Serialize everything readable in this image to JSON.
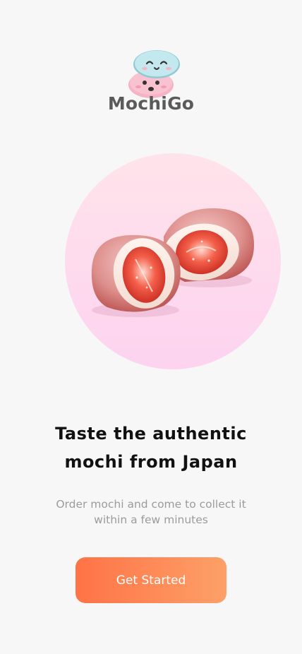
{
  "brand": {
    "name": "MochiGo",
    "logo_icon": "mochi-stack-icon",
    "text_color": "#5a5a5a"
  },
  "hero": {
    "image": "strawberry-mochi",
    "circle_gradient": [
      "#ffe3ea",
      "#fdd3f0"
    ]
  },
  "onboarding": {
    "headline_line1": "Taste the authentic",
    "headline_line2": "mochi from Japan",
    "subtitle_line1": "Order mochi and come to collect it",
    "subtitle_line2": "within a few minutes"
  },
  "cta": {
    "label": "Get Started",
    "gradient": [
      "#ff7346",
      "#fda068"
    ]
  }
}
